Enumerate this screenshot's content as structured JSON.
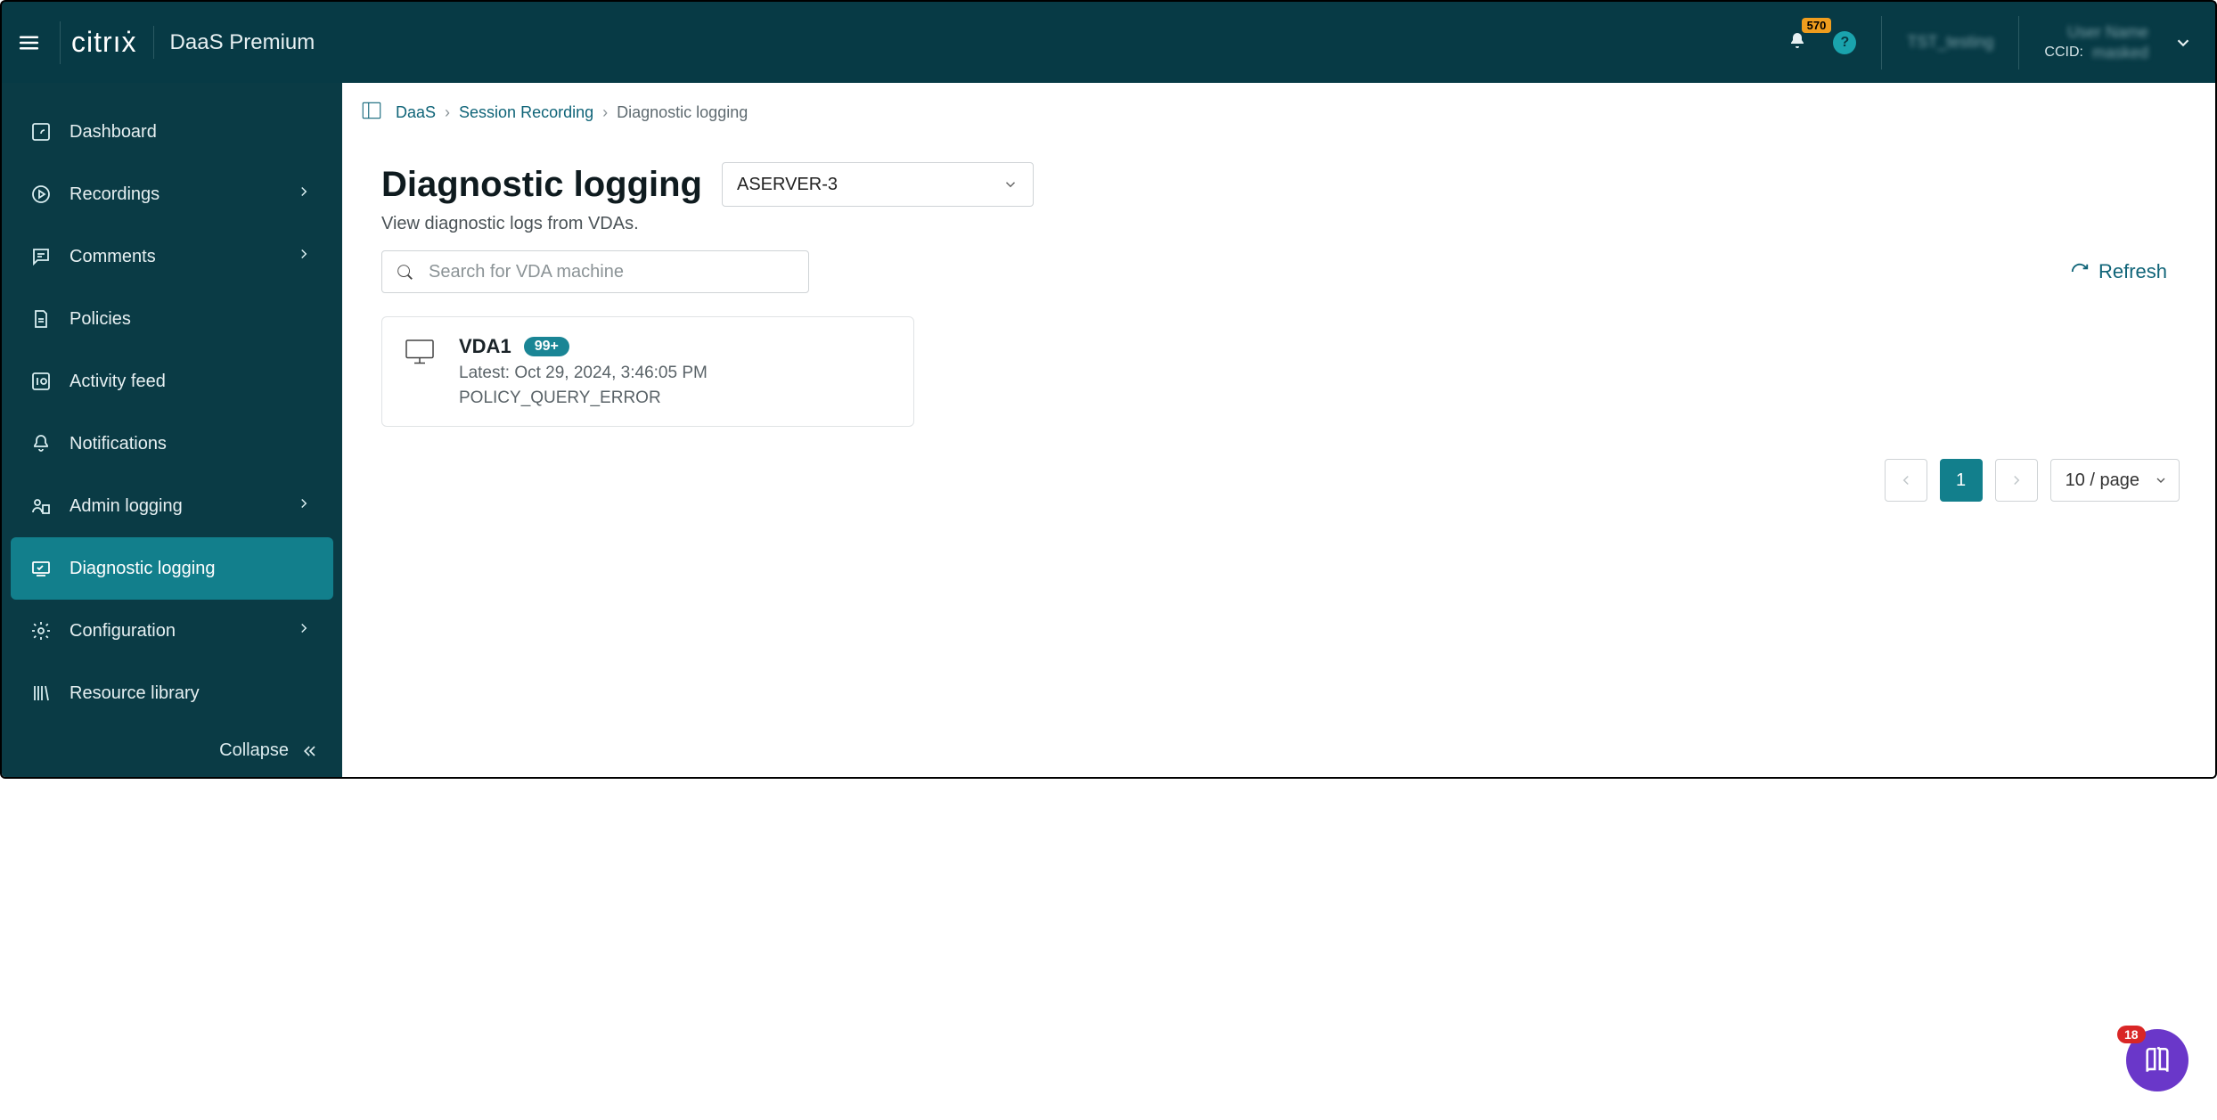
{
  "header": {
    "logo_text": "citrıẋ",
    "product": "DaaS Premium",
    "notification_count": "570",
    "help_label": "?",
    "tenant_masked": "TST_testing",
    "user_masked": "User Name",
    "ccid_label": "CCID:",
    "ccid_value_masked": "masked"
  },
  "sidebar": {
    "items": [
      {
        "label": "Dashboard",
        "icon": "dashboard",
        "expandable": false,
        "active": false
      },
      {
        "label": "Recordings",
        "icon": "play",
        "expandable": true,
        "active": false
      },
      {
        "label": "Comments",
        "icon": "comment",
        "expandable": true,
        "active": false
      },
      {
        "label": "Policies",
        "icon": "policy",
        "expandable": false,
        "active": false
      },
      {
        "label": "Activity feed",
        "icon": "activity",
        "expandable": false,
        "active": false
      },
      {
        "label": "Notifications",
        "icon": "bell",
        "expandable": false,
        "active": false
      },
      {
        "label": "Admin logging",
        "icon": "admin",
        "expandable": true,
        "active": false
      },
      {
        "label": "Diagnostic logging",
        "icon": "diagnostic",
        "expandable": false,
        "active": true
      },
      {
        "label": "Configuration",
        "icon": "gear",
        "expandable": true,
        "active": false
      },
      {
        "label": "Resource library",
        "icon": "library",
        "expandable": false,
        "active": false
      }
    ],
    "collapse_label": "Collapse"
  },
  "breadcrumbs": {
    "items": [
      {
        "label": "DaaS",
        "link": true
      },
      {
        "label": "Session Recording",
        "link": true
      },
      {
        "label": "Diagnostic logging",
        "link": false
      }
    ]
  },
  "page": {
    "title": "Diagnostic logging",
    "server_selected": "ASERVER-3",
    "subtitle": "View diagnostic logs from VDAs.",
    "search_placeholder": "Search for VDA machine",
    "refresh_label": "Refresh"
  },
  "cards": [
    {
      "name": "VDA1",
      "badge": "99+",
      "latest_prefix": "Latest: ",
      "latest_time": "Oct 29, 2024, 3:46:05 PM",
      "error_code": "POLICY_QUERY_ERROR"
    }
  ],
  "pagination": {
    "current": "1",
    "page_size_label": "10 / page"
  },
  "fab": {
    "badge": "18"
  }
}
